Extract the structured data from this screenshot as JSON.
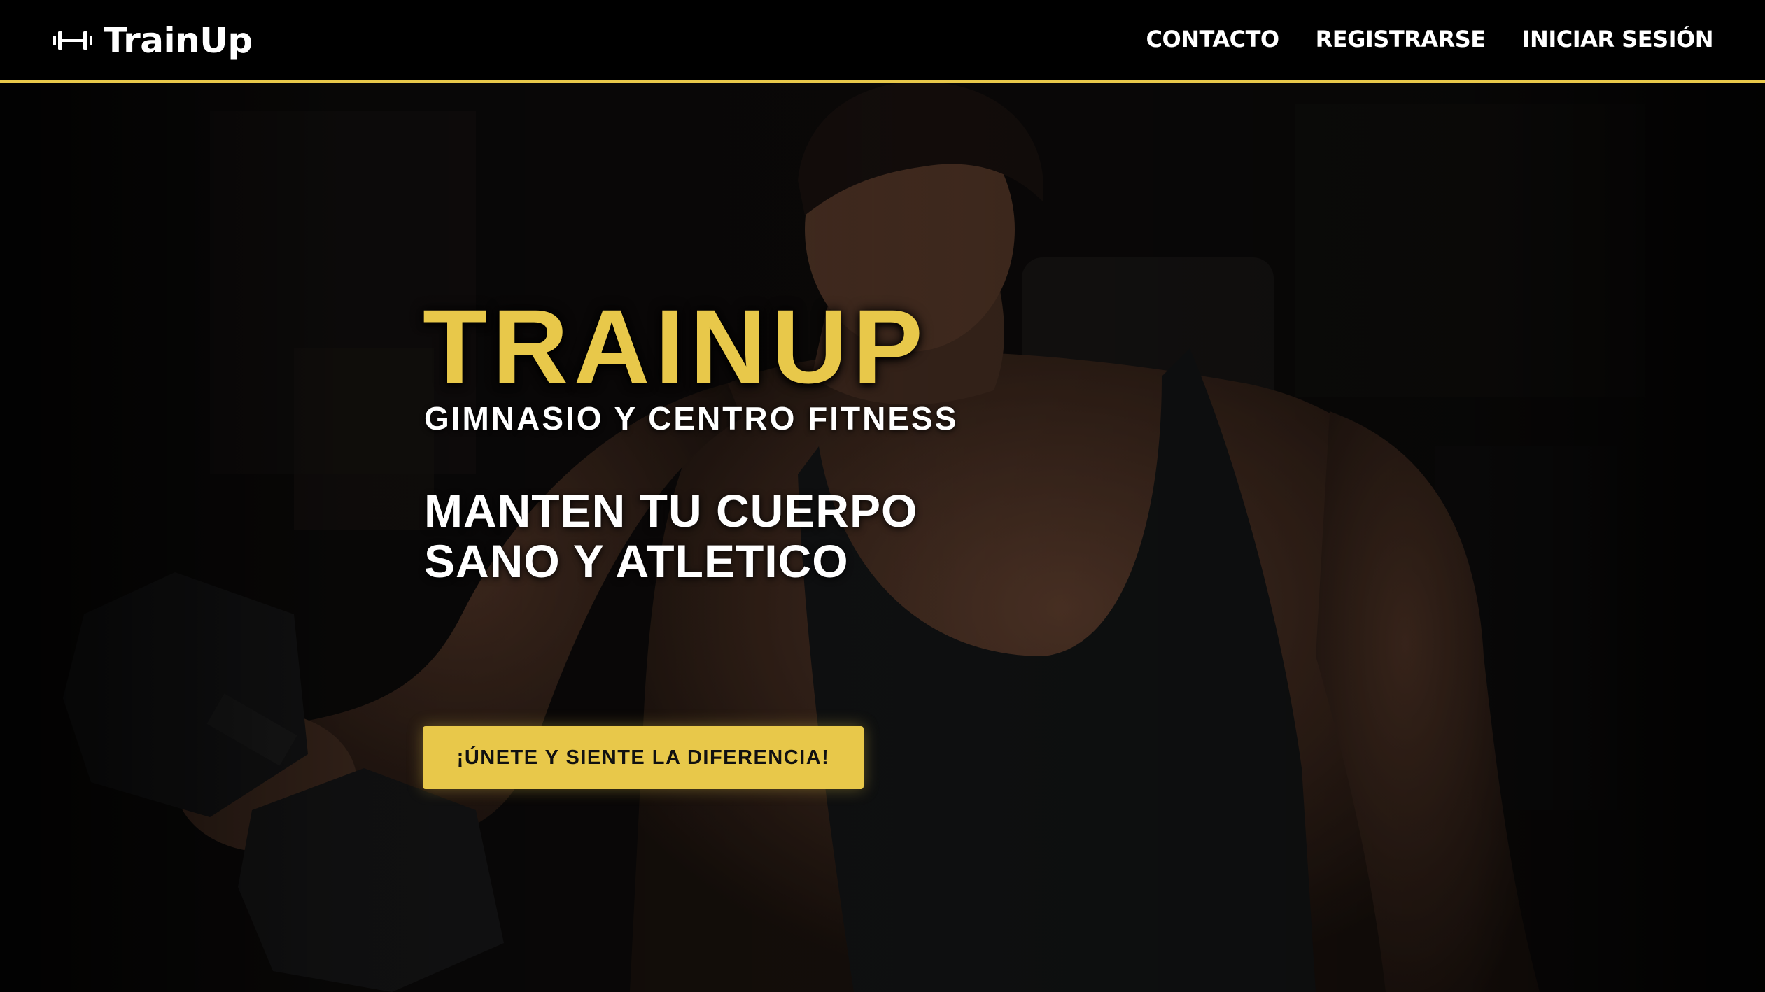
{
  "brand": {
    "name": "TrainUp",
    "icon": "dumbbell-icon"
  },
  "nav": {
    "items": [
      {
        "label": "CONTACTO"
      },
      {
        "label": "REGISTRARSE"
      },
      {
        "label": "INICIAR SESIÓN"
      }
    ]
  },
  "hero": {
    "title": "TRAINUP",
    "subtitle": "GIMNASIO Y CENTRO FITNESS",
    "tagline_line1": "MANTEN TU CUERPO",
    "tagline_line2": "SANO Y ATLETICO",
    "cta_label": "¡ÚNETE Y SIENTE LA DIFERENCIA!",
    "background": "gym-athlete-photo"
  },
  "colors": {
    "accent": "#e8c84a",
    "navbar_bg": "#000000",
    "text": "#ffffff"
  }
}
